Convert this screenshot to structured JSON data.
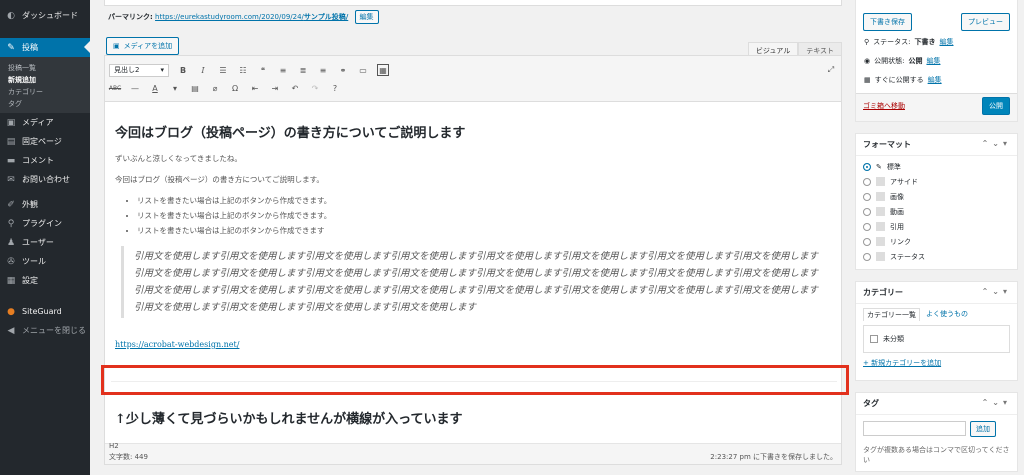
{
  "sidebar": {
    "items": [
      {
        "label": "ダッシュボード",
        "icon": "dashboard-icon"
      },
      {
        "label": "投稿",
        "icon": "pin-icon",
        "active": true
      },
      {
        "label": "メディア",
        "icon": "media-icon"
      },
      {
        "label": "固定ページ",
        "icon": "page-icon"
      },
      {
        "label": "コメント",
        "icon": "comment-icon"
      },
      {
        "label": "お問い合わせ",
        "icon": "mail-icon"
      },
      {
        "label": "外観",
        "icon": "brush-icon"
      },
      {
        "label": "プラグイン",
        "icon": "plugin-icon"
      },
      {
        "label": "ユーザー",
        "icon": "user-icon"
      },
      {
        "label": "ツール",
        "icon": "wrench-icon"
      },
      {
        "label": "設定",
        "icon": "settings-icon"
      },
      {
        "label": "SiteGuard",
        "icon": "siteguard-icon"
      },
      {
        "label": "メニューを閉じる",
        "icon": "collapse-icon"
      }
    ],
    "submenu": [
      "投稿一覧",
      "新規追加",
      "カテゴリー",
      "タグ"
    ]
  },
  "editor": {
    "permalink_label": "パーマリンク:",
    "permalink_url": "https://eurekastudyroom.com/2020/09/24/",
    "permalink_slug": "サンプル投稿/",
    "edit_button": "編集",
    "media_button": "メディアを追加",
    "tab_visual": "ビジュアル",
    "tab_text": "テキスト",
    "format_select": "見出し2",
    "heading1": "今回はブログ（投稿ページ）の書き方についてご説明します",
    "para1": "ずいぶんと涼しくなってきましたね。",
    "para2": "今回はブログ（投稿ページ）の書き方についてご説明します。",
    "list": [
      "リストを書きたい場合は上記のボタンから作成できます。",
      "リストを書きたい場合は上記のボタンから作成できます。",
      "リストを書きたい場合は上記のボタンから作成できます"
    ],
    "quote": "引用文を使用します引用文を使用します引用文を使用します引用文を使用します引用文を使用します引用文を使用します引用文を使用します引用文を使用します引用文を使用します引用文を使用します引用文を使用します引用文を使用します引用文を使用します引用文を使用します引用文を使用します引用文を使用します引用文を使用します引用文を使用します引用文を使用します引用文を使用します引用文を使用します引用文を使用します引用文を使用します引用文を使用します引用文を使用します引用文を使用します引用文を使用します引用文を使用します",
    "link": "https://acrobat-webdesign.net/",
    "heading2": "↑少し薄くて見づらいかもしれませんが横線が入っています",
    "path": "H2",
    "word_count": "文字数: 449",
    "saved": "2:23:27 pm に下書きを保存しました。"
  },
  "publish": {
    "save_draft": "下書き保存",
    "preview": "プレビュー",
    "status_label": "ステータス:",
    "status_value": "下書き",
    "visibility_label": "公開状態:",
    "visibility_value": "公開",
    "schedule_label": "すぐに公開する",
    "edit": "編集",
    "trash": "ゴミ箱へ移動",
    "publish": "公開"
  },
  "format_box": {
    "title": "フォーマット",
    "options": [
      "標準",
      "アサイド",
      "画像",
      "動画",
      "引用",
      "リンク",
      "ステータス"
    ]
  },
  "category_box": {
    "title": "カテゴリー",
    "tab_all": "カテゴリー一覧",
    "tab_popular": "よく使うもの",
    "item": "未分類",
    "add_link": "+ 新規カテゴリーを追加"
  },
  "tag_box": {
    "title": "タグ",
    "add": "追加",
    "hint": "タグが複数ある場合はコンマで区切ってください"
  },
  "colors": {
    "accent": "#0073aa",
    "highlight": "#e2311d",
    "sidebar": "#23282d"
  }
}
